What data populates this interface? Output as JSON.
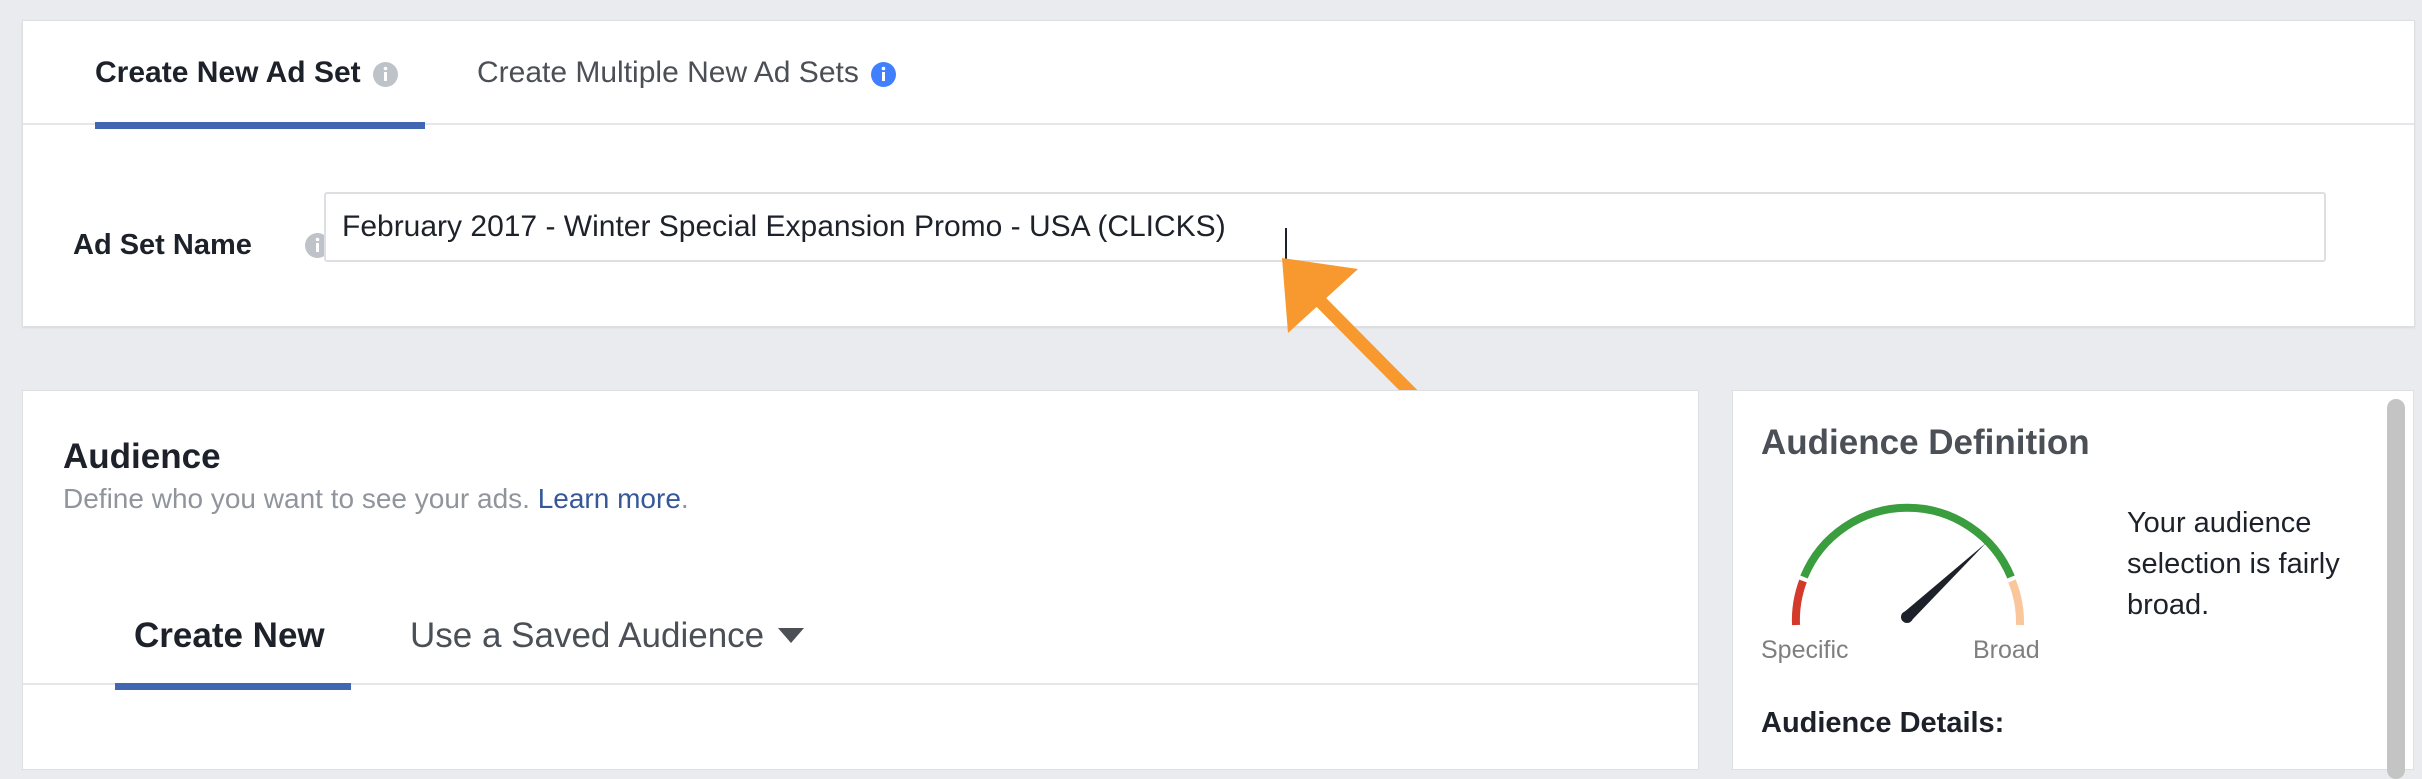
{
  "top_tabs": {
    "create_new_ad_set": "Create New Ad Set",
    "create_multiple": "Create Multiple New Ad Sets"
  },
  "ad_set_name": {
    "label": "Ad Set Name",
    "value": "February 2017 - Winter Special Expansion Promo - USA (CLICKS)"
  },
  "audience": {
    "title": "Audience",
    "subtitle": "Define who you want to see your ads.",
    "learn_more": "Learn more",
    "subtitle_end": ".",
    "tabs": {
      "create_new": "Create New",
      "saved_audience": "Use a Saved Audience"
    }
  },
  "definition": {
    "title": "Audience Definition",
    "gauge_specific": "Specific",
    "gauge_broad": "Broad",
    "message": "Your audience selection is fairly broad.",
    "details_heading": "Audience Details:"
  },
  "colors": {
    "accent_blue": "#4267b2",
    "link_blue": "#365899",
    "annotation_orange": "#f7992f",
    "gauge_green": "#3a9d3e",
    "gauge_red": "#d33a2c",
    "gauge_peach": "#f9c79b"
  },
  "icons": {
    "info_grey": "info-circle-icon",
    "info_blue": "info-circle-icon",
    "dropdown": "caret-down-icon",
    "gauge_needle": "needle-icon"
  }
}
